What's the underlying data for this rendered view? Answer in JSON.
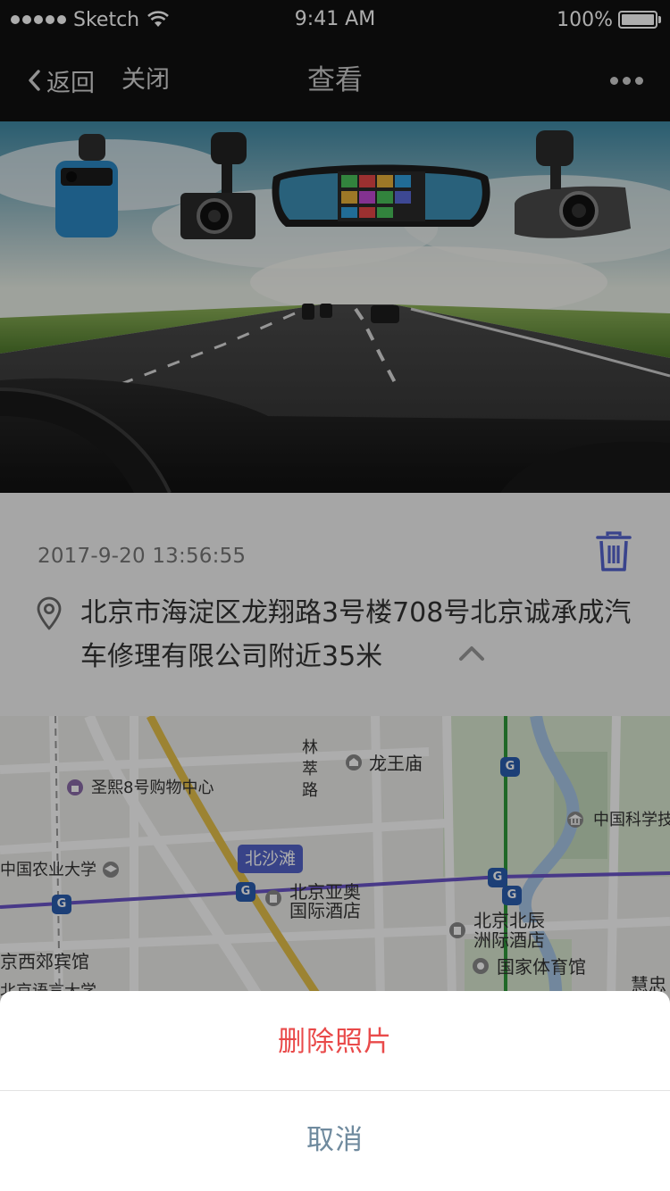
{
  "status_bar": {
    "carrier": "Sketch",
    "time": "9:41 AM",
    "battery": "100%",
    "signal_icon": "signal-dots-icon",
    "wifi_icon": "wifi-icon",
    "battery_icon": "battery-icon",
    "battery_level": 1.0
  },
  "nav": {
    "back_label": "返回",
    "close_label": "关闭",
    "title": "查看",
    "back_icon": "chevron-left-icon",
    "more_icon": "more-dots-icon"
  },
  "photo": {
    "alt_icon": "dashcam-photo"
  },
  "info": {
    "timestamp": "2017-9-20  13:56:55",
    "address": "北京市海淀区龙翔路3号楼708号北京诚承成汽车修理有限公司附近35米",
    "delete_icon": "trash-icon",
    "location_icon": "location-pin-icon",
    "collapse_icon": "chevron-up-icon"
  },
  "map": {
    "labels": {
      "road_lincui": "林萃路",
      "longwangmiao": "龙王庙",
      "shengxi_mall": "圣熙8号购物中心",
      "cas": "中国科学技",
      "beishatan": "北沙滩",
      "cau": "中国农业大学",
      "beijing_yaoao": "北京亚奥",
      "intl_hotel": "国际酒店",
      "beichen_1": "北京北辰",
      "beichen_2": "洲际酒店",
      "xijiao_hotel": "京西郊宾馆",
      "stadium": "国家体育馆",
      "huizhong": "慧忠",
      "language_univ": "北京语言大学"
    },
    "colors": {
      "metro_line_purple": "#6a55c9",
      "metro_line_green": "#2e9a3a",
      "main_road": "#e6c24b",
      "station_tag": "#5363c9"
    }
  },
  "action_sheet": {
    "delete_label": "删除照片",
    "cancel_label": "取消",
    "delete_color": "#e94a4a",
    "cancel_color": "#6f8a9e"
  }
}
